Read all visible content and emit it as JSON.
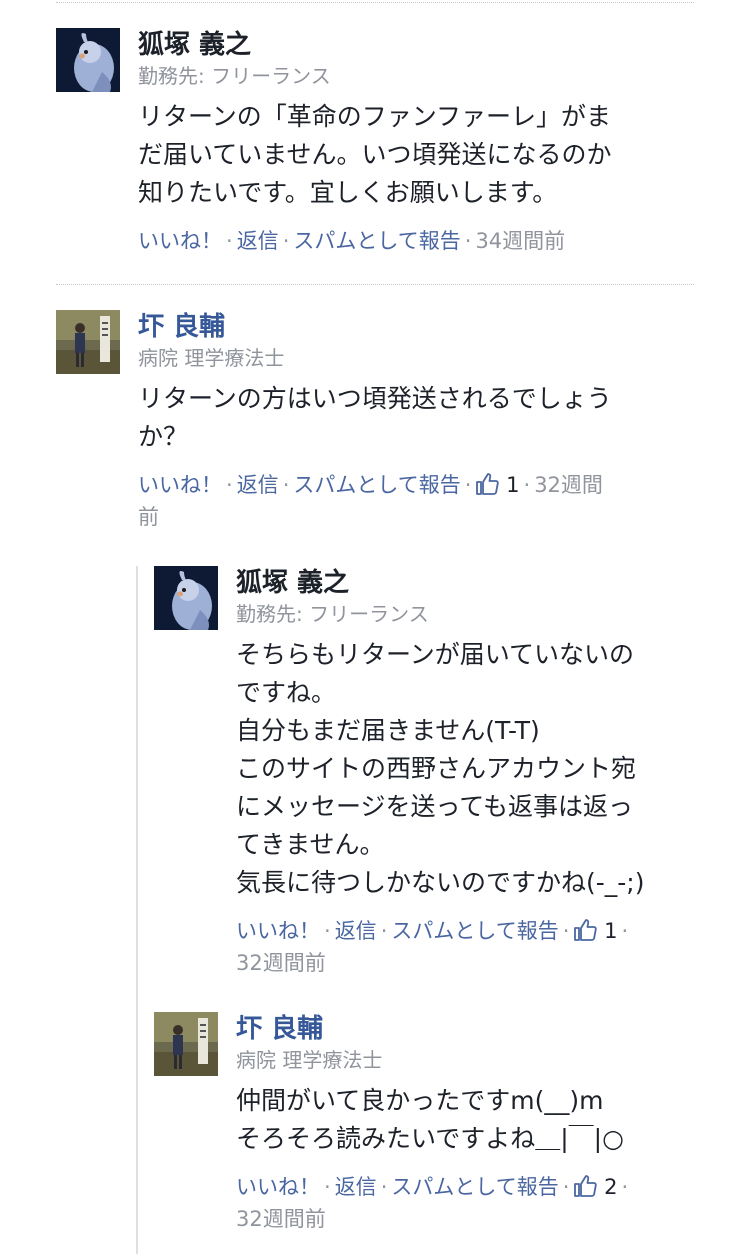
{
  "actions": {
    "like": "いいね！",
    "reply": "返信",
    "report": "スパムとして報告",
    "sep": "·"
  },
  "comments": [
    {
      "author": "狐塚 義之",
      "subtitle": "勤務先: フリーランス",
      "lines": [
        "リターンの「革命のファンファーレ」がま",
        "だ届いていません。いつ頃発送になるのか",
        "知りたいです。宜しくお願いします。"
      ],
      "time": "34週間前"
    },
    {
      "author": "圷 良輔",
      "subtitle": "病院 理学療法士",
      "lines": [
        "リターンの方はいつ頃発送されるでしょう",
        "か？"
      ],
      "likes": "1",
      "time_a": "32週間",
      "time_b": "前"
    },
    {
      "author": "狐塚 義之",
      "subtitle": "勤務先: フリーランス",
      "lines": [
        "そちらもリターンが届いていないの",
        "ですね。",
        "自分もまだ届きません(T-T)",
        "このサイトの西野さんアカウント宛",
        "にメッセージを送っても返事は返っ",
        "てきません。",
        "気長に待つしかないのですかね(-_-;)"
      ],
      "likes": "1",
      "time": "32週間前"
    },
    {
      "author": "圷 良輔",
      "subtitle": "病院 理学療法士",
      "lines": [
        "仲間がいて良かったですm(__)m",
        "そろそろ読みたいですよね＿|￣|○"
      ],
      "likes": "2",
      "time": "32週間前"
    }
  ],
  "colors": {
    "link": "#4b67a1",
    "author_blue": "#365899",
    "muted": "#90949c",
    "text": "#1d2129"
  },
  "icons": {
    "avatar_1": "cockatiel-bird-photo",
    "avatar_2": "person-standing-photo",
    "like": "thumbs-up-icon"
  }
}
